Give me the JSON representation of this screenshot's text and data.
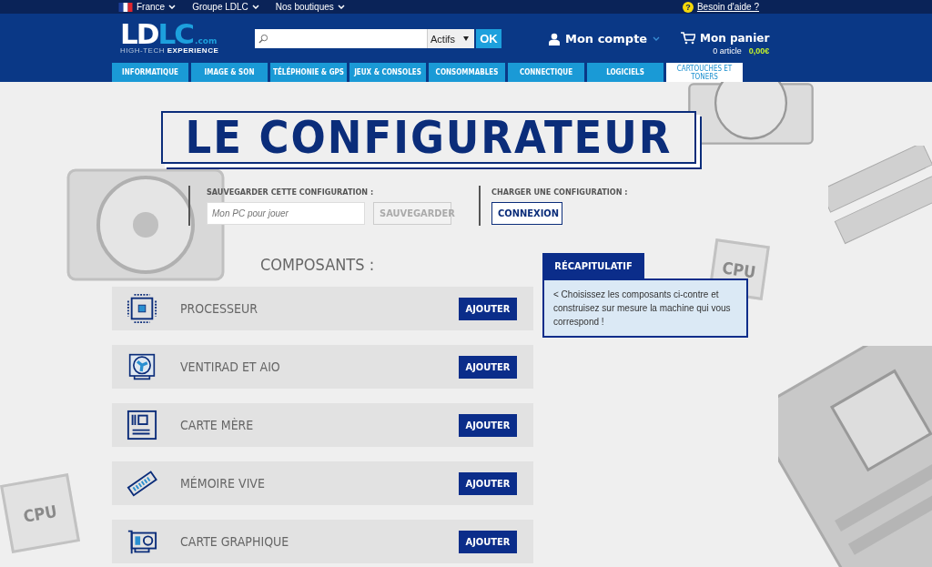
{
  "topbar": {
    "links": [
      {
        "label": "France",
        "kind": "flag"
      },
      {
        "label": "Groupe LDLC",
        "kind": "plain"
      },
      {
        "label": "Nos boutiques",
        "kind": "plain"
      }
    ],
    "help_icon": "?",
    "help": "Besoin d'aide ?"
  },
  "header": {
    "logo": {
      "main": "LDLC",
      "suffix": ".com",
      "tagline_a": "HIGH-TECH",
      "tagline_b": "EXPERIENCE"
    },
    "search": {
      "filter": "Actifs",
      "button": "OK"
    },
    "account": "Mon compte",
    "cart": {
      "title": "Mon panier",
      "count": "0 article",
      "total": "0,00€"
    }
  },
  "nav": [
    {
      "label": "INFORMATIQUE",
      "selected": false
    },
    {
      "label": "IMAGE & SON",
      "selected": false
    },
    {
      "label": "TÉLÉPHONIE & GPS",
      "selected": false
    },
    {
      "label": "JEUX & CONSOLES",
      "selected": false
    },
    {
      "label": "CONSOMMABLES",
      "selected": false
    },
    {
      "label": "CONNECTIQUE",
      "selected": false
    },
    {
      "label": "LOGICIELS",
      "selected": false
    },
    {
      "label": "CARTOUCHES ET TONERS",
      "selected": true
    }
  ],
  "title": "LE CONFIGURATEUR",
  "save": {
    "label": "SAUVEGARDER CETTE CONFIGURATION :",
    "placeholder": "Mon PC pour jouer",
    "button": "SAUVEGARDER",
    "disabled": true
  },
  "load": {
    "label": "CHARGER UNE CONFIGURATION :",
    "button": "CONNEXION"
  },
  "components_heading": "COMPOSANTS :",
  "components": [
    {
      "kind": "cpu",
      "name": "PROCESSEUR",
      "button": "AJOUTER"
    },
    {
      "kind": "cooler",
      "name": "VENTIRAD ET AIO",
      "button": "AJOUTER"
    },
    {
      "kind": "motherboard",
      "name": "CARTE MÈRE",
      "button": "AJOUTER"
    },
    {
      "kind": "ram",
      "name": "MÉMOIRE VIVE",
      "button": "AJOUTER"
    },
    {
      "kind": "gpu",
      "name": "CARTE GRAPHIQUE",
      "button": "AJOUTER"
    }
  ],
  "summary": {
    "tab": "RÉCAPITULATIF",
    "text": "< Choisissez les composants ci-contre et construisez sur mesure la machine qui vous correspond !"
  },
  "decor_labels": [
    "CPU",
    "CPU"
  ]
}
